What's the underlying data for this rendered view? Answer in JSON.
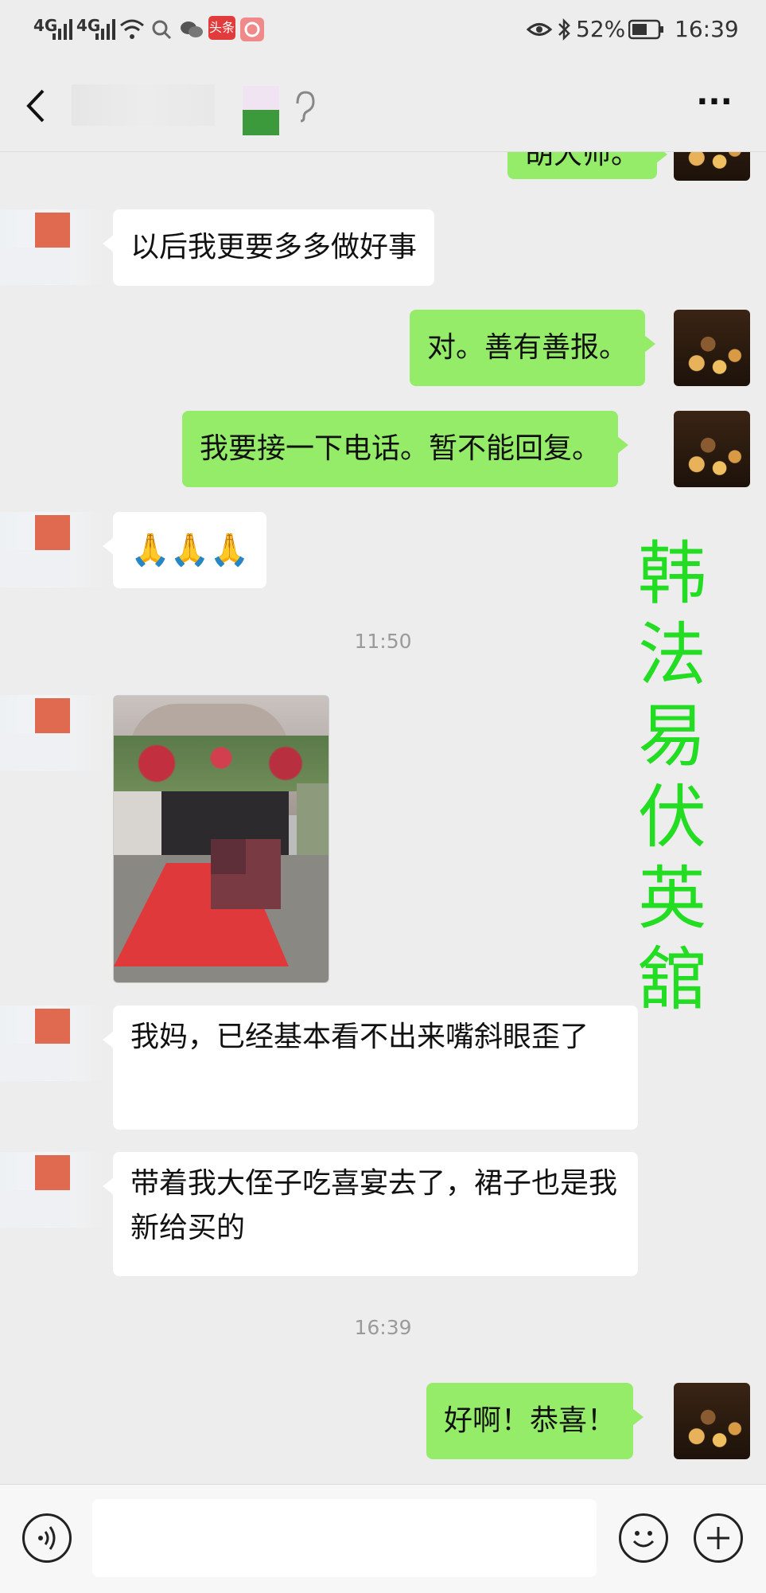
{
  "status_bar": {
    "signal1": "4G",
    "signal2": "4G",
    "app_badge1": "头条",
    "battery_percent": "52%",
    "time": "16:39"
  },
  "header": {
    "back_icon": "chevron-left-icon",
    "ear_icon": "ear-icon",
    "more_icon": "ellipsis-icon",
    "more_label": "···"
  },
  "messages": [
    {
      "side": "out",
      "type": "text",
      "text": "胡大师。"
    },
    {
      "side": "in",
      "type": "text",
      "text": "以后我更要多多做好事"
    },
    {
      "side": "out",
      "type": "text",
      "text": "对。善有善报。"
    },
    {
      "side": "out",
      "type": "text",
      "text": "我要接一下电话。暂不能回复。"
    },
    {
      "side": "in",
      "type": "emoji",
      "text": "🙏🙏🙏"
    },
    {
      "type": "time",
      "text": "11:50"
    },
    {
      "side": "in",
      "type": "image",
      "description": "photo"
    },
    {
      "side": "in",
      "type": "text",
      "text": "我妈，已经基本看不出来嘴斜眼歪了"
    },
    {
      "side": "in",
      "type": "text",
      "text": "带着我大侄子吃喜宴去了，裙子也是我新给买的"
    },
    {
      "type": "time",
      "text": "16:39"
    },
    {
      "side": "out",
      "type": "text",
      "text": "好啊！恭喜！"
    }
  ],
  "watermark": "韩法易伏英舘",
  "input_bar": {
    "voice_icon": "voice-icon",
    "emoji_icon": "smiley-icon",
    "plus_icon": "plus-icon"
  },
  "colors": {
    "background": "#ededed",
    "outgoing_bubble": "#95ec69",
    "incoming_bubble": "#ffffff",
    "watermark": "#22dd22"
  }
}
